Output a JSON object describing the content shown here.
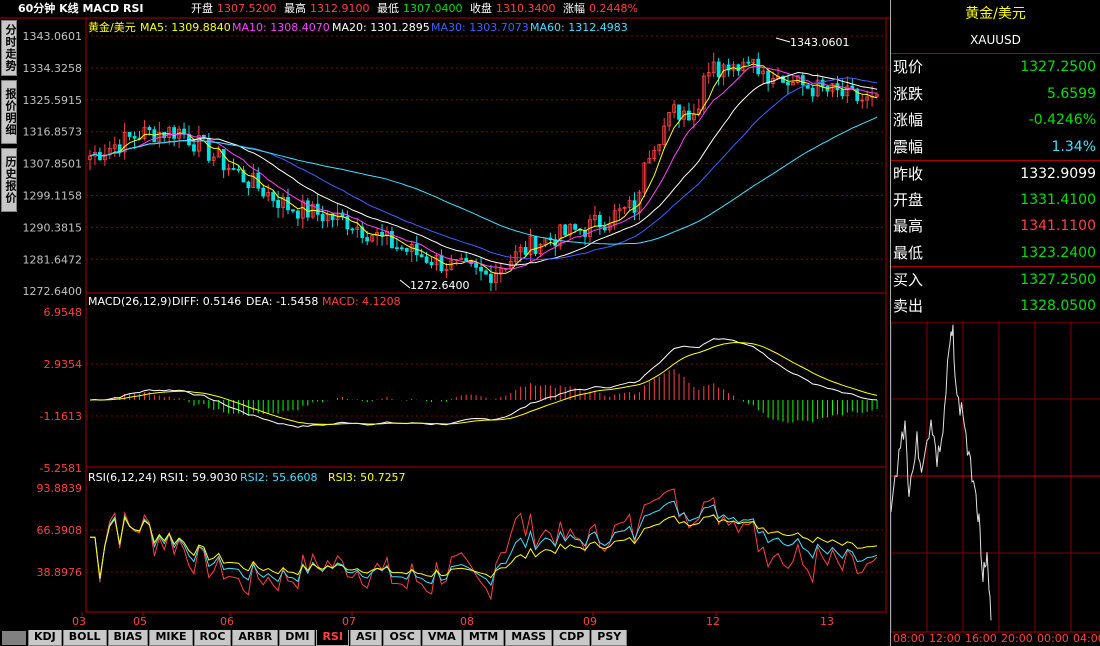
{
  "title_bar": {
    "chart_name": "60分钟 K线 MACD RSI",
    "open_label": "开盘",
    "open_value": "1307.5200",
    "high_label": "最高",
    "high_value": "1312.9100",
    "low_label": "最低",
    "low_value": "1307.0400",
    "close_label": "收盘",
    "close_value": "1310.3400",
    "change_label": "涨幅",
    "change_value": "0.2448%"
  },
  "left_tabs": [
    "分时走势",
    "报价明细",
    "历史报价"
  ],
  "main_panel": {
    "legend_name": "黄金/美元",
    "ma5": "MA5: 1309.8840",
    "ma10": "MA10: 1308.4070",
    "ma20": "MA20: 1301.2895",
    "ma30": "MA30: 1303.7073",
    "ma60": "MA60: 1312.4983",
    "price_ticks": [
      "1343.0601",
      "1334.3258",
      "1325.5915",
      "1316.8573",
      "1307.8501",
      "1299.1158",
      "1290.3815",
      "1281.6472",
      "1272.6400"
    ],
    "high_marker": "1343.0601",
    "low_marker": "1272.6400"
  },
  "macd_panel": {
    "label": "MACD(26,12,9)",
    "diff": "DIFF: 0.5146",
    "dea": "DEA: -1.5458",
    "macd": "MACD: 4.1208",
    "ticks": [
      "6.9548",
      "2.9354",
      "-1.1613",
      "-5.2581"
    ]
  },
  "rsi_panel": {
    "label": "RSI(6,12,24)",
    "rsi1": "RSI1: 59.9030",
    "rsi2": "RSI2: 55.6608",
    "rsi3": "RSI3: 50.7257",
    "ticks": [
      "93.8839",
      "66.3908",
      "38.8976"
    ]
  },
  "x_axis": [
    "03",
    "05",
    "06",
    "07",
    "08",
    "09",
    "12",
    "13"
  ],
  "quote": {
    "name": "黄金/美元",
    "code": "XAUUSD",
    "rows": [
      {
        "label": "现价",
        "value": "1327.2500",
        "color": "#00e000"
      },
      {
        "label": "涨跌",
        "value": "5.6599",
        "color": "#00e000"
      },
      {
        "label": "涨幅",
        "value": "-0.4246%",
        "color": "#00e000"
      },
      {
        "label": "震幅",
        "value": "1.34%",
        "color": "#40e0ff"
      },
      {
        "label": "昨收",
        "value": "1332.9099",
        "color": "#ffffff"
      },
      {
        "label": "开盘",
        "value": "1331.4100",
        "color": "#00e000"
      },
      {
        "label": "最高",
        "value": "1341.1100",
        "color": "#ff4040"
      },
      {
        "label": "最低",
        "value": "1323.2400",
        "color": "#00e000"
      },
      {
        "label": "买入",
        "value": "1327.2500",
        "color": "#00e000"
      },
      {
        "label": "卖出",
        "value": "1328.0500",
        "color": "#00e000"
      }
    ]
  },
  "mini_chart": {
    "x_ticks": [
      "08:00",
      "12:00",
      "16:00",
      "20:00",
      "00:00",
      "04:00"
    ]
  },
  "bottom_tabs": [
    "KDJ",
    "BOLL",
    "BIAS",
    "MIKE",
    "ROC",
    "ARBR",
    "DMI",
    "RSI",
    "ASI",
    "OSC",
    "VMA",
    "MTM",
    "MASS",
    "CDP",
    "PSY"
  ],
  "active_tab": "RSI",
  "colors": {
    "up": "#ff4040",
    "down": "#00e0e0",
    "ma5": "#ffffff",
    "ma10": "#ffff00",
    "ma20": "#ff40ff",
    "ma30": "#4060ff",
    "ma60": "#40e0ff",
    "grid": "#800000",
    "macd_up": "#ff4040",
    "macd_down": "#00ff00"
  }
}
